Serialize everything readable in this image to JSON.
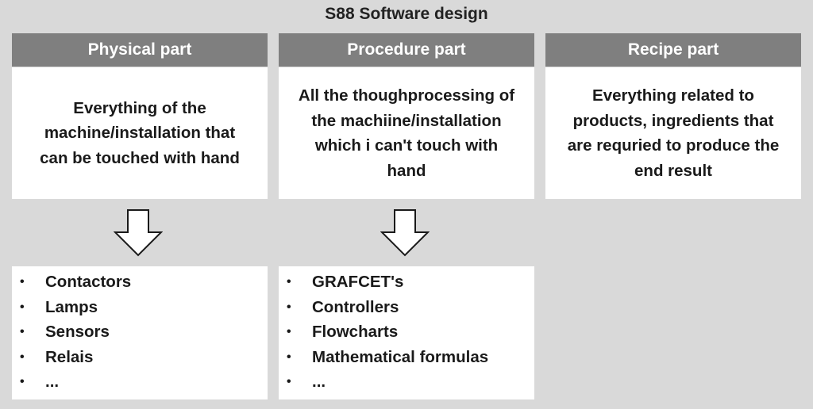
{
  "title": "S88 Software design",
  "columns": [
    {
      "header": "Physical part",
      "description": [
        "Everything of the",
        "machine/installation that",
        "can be touched with hand"
      ],
      "items": [
        "Contactors",
        "Lamps",
        "Sensors",
        "Relais",
        "..."
      ]
    },
    {
      "header": "Procedure part",
      "description": [
        "All the thoughprocessing of",
        "the machiine/installation",
        "which i can't touch with",
        "hand"
      ],
      "items": [
        "GRAFCET's",
        "Controllers",
        "Flowcharts",
        "Mathematical formulas",
        "..."
      ]
    },
    {
      "header": "Recipe part",
      "description": [
        "Everything related to",
        "products, ingredients that",
        "are requried to produce the",
        "end result"
      ]
    }
  ],
  "bullet_symbol": "•",
  "colors": {
    "background": "#d9d9d9",
    "header_fill": "#7f7f7f",
    "header_text": "#ffffff",
    "box_fill": "#ffffff"
  }
}
